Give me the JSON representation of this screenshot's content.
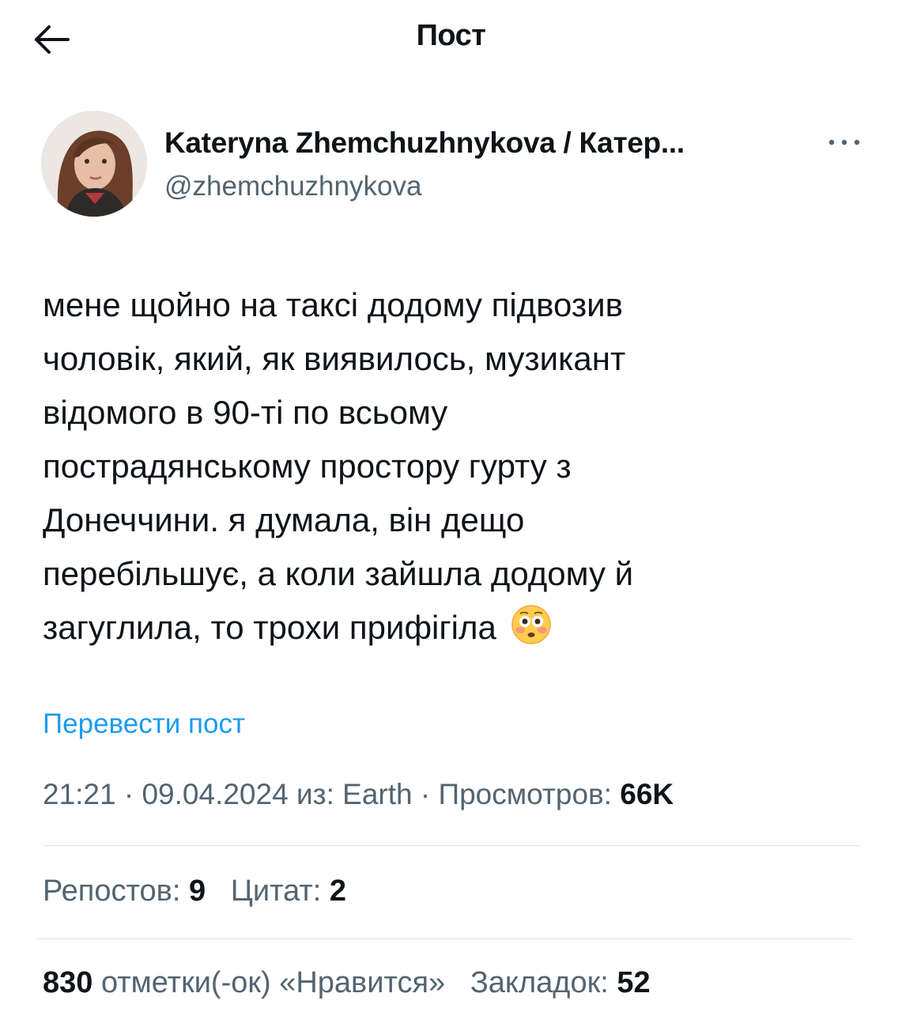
{
  "header": {
    "title": "Пост",
    "back_icon": "arrow-left-icon"
  },
  "author": {
    "display_name": "Kateryna Zhemchuzhnykova / Катер...",
    "handle": "@zhemchuzhnykova",
    "more_icon": "more-horizontal-icon"
  },
  "tweet": {
    "lines": [
      "мене щойно на таксі додому підвозив",
      "чоловік, який, як виявилось, музикант",
      "відомого в 90-ті по всьому",
      "пострадянському простору гурту з",
      "Донеччини. я думала, він дещо",
      "перебільшує, а коли зайшла додому й",
      "загуглила, то трохи прифігіла"
    ],
    "emoji": "flushed-face-emoji",
    "translate_label": "Перевести пост"
  },
  "meta": {
    "time": "21:21",
    "date": "09.04.2024",
    "source_prefix": "из:",
    "source": "Earth",
    "views_label": "Просмотров:",
    "views": "66K",
    "separator": "·"
  },
  "stats": {
    "reposts_label": "Репостов:",
    "reposts": "9",
    "quotes_label": "Цитат:",
    "quotes": "2",
    "likes": "830",
    "likes_label": "отметки(-ок) «Нравится»",
    "bookmarks_label": "Закладок:",
    "bookmarks": "52"
  },
  "colors": {
    "text": "#0f1419",
    "secondary": "#536471",
    "link": "#1d9bf0",
    "divider": "#dfe3e6"
  }
}
